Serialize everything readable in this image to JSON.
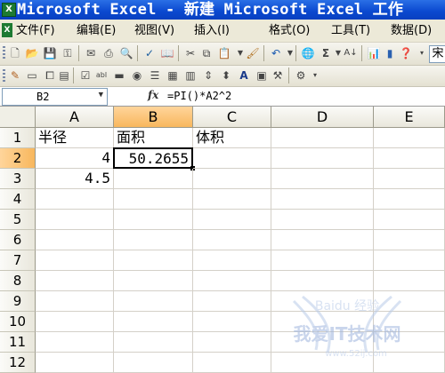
{
  "window": {
    "title": "Microsoft Excel - 新建 Microsoft Excel 工作"
  },
  "menu": {
    "items": [
      "文件(F)",
      "编辑(E)",
      "视图(V)",
      "插入(I)",
      "格式(O)",
      "工具(T)",
      "数据(D)"
    ]
  },
  "formula_bar": {
    "name_box": "B2",
    "fx_label": "fx",
    "formula": "=PI()*A2^2"
  },
  "toolbar": {
    "font_box": "宋"
  },
  "columns": [
    "A",
    "B",
    "C",
    "D",
    "E"
  ],
  "rows": [
    "1",
    "2",
    "3",
    "4",
    "5",
    "6",
    "7",
    "8",
    "9",
    "10",
    "11",
    "12"
  ],
  "cells": {
    "A1": "半径",
    "B1": "面积",
    "C1": "体积",
    "A2": "4",
    "B2": "50.2655",
    "A3": "4.5"
  },
  "selected_cell": "B2",
  "watermark": {
    "text": "我爱IT技术网",
    "sub": "www.52ij.com",
    "brand": "Baidu 经验"
  },
  "colors": {
    "title_bar": "#0a48cf",
    "header_active": "#f8b75d"
  }
}
